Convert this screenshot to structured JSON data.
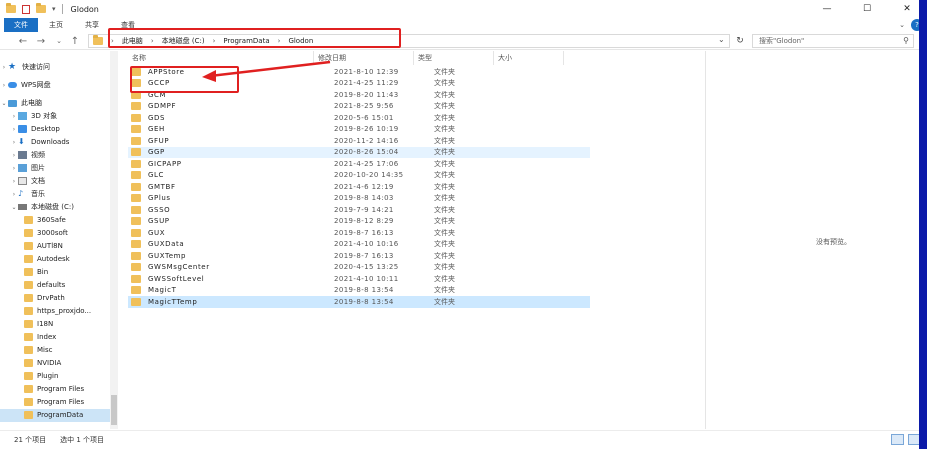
{
  "window": {
    "title": "Glodon",
    "controls": [
      "—",
      "☐",
      "✕"
    ]
  },
  "ribbon": {
    "tabs": [
      "文件",
      "主页",
      "共享",
      "查看"
    ],
    "help_icon": "?"
  },
  "address": {
    "segments": [
      "此电脑",
      "本地磁盘 (C:)",
      "ProgramData",
      "Glodon"
    ],
    "search_placeholder": "搜索\"Glodon\""
  },
  "sidebar": {
    "items": [
      {
        "label": "快速访问",
        "icon": "star-icon"
      },
      {
        "label": "WPS网盘",
        "icon": "cloud-icon"
      },
      {
        "label": "此电脑",
        "icon": "pc-icon"
      },
      {
        "label": "3D 对象",
        "icon": "cube-icon"
      },
      {
        "label": "Desktop",
        "icon": "desktop-icon"
      },
      {
        "label": "Downloads",
        "icon": "download-icon"
      },
      {
        "label": "视频",
        "icon": "video-icon"
      },
      {
        "label": "图片",
        "icon": "picture-icon"
      },
      {
        "label": "文档",
        "icon": "document-icon"
      },
      {
        "label": "音乐",
        "icon": "music-icon"
      },
      {
        "label": "本地磁盘 (C:)",
        "icon": "drive-icon"
      },
      {
        "label": "360Safe",
        "icon": "folder-icon"
      },
      {
        "label": "3000soft",
        "icon": "folder-icon"
      },
      {
        "label": "AUTl8N",
        "icon": "folder-icon"
      },
      {
        "label": "Autodesk",
        "icon": "folder-icon"
      },
      {
        "label": "Bin",
        "icon": "folder-icon"
      },
      {
        "label": "defaults",
        "icon": "folder-icon"
      },
      {
        "label": "DrvPath",
        "icon": "folder-icon"
      },
      {
        "label": "https_proxjdo...",
        "icon": "folder-icon"
      },
      {
        "label": "I18N",
        "icon": "folder-icon"
      },
      {
        "label": "Index",
        "icon": "folder-icon"
      },
      {
        "label": "Misc",
        "icon": "folder-icon"
      },
      {
        "label": "NVIDIA",
        "icon": "folder-icon"
      },
      {
        "label": "Plugin",
        "icon": "folder-icon"
      },
      {
        "label": "Program Files",
        "icon": "folder-icon"
      },
      {
        "label": "Program Files",
        "icon": "folder-icon"
      },
      {
        "label": "ProgramData",
        "icon": "folder-icon"
      }
    ]
  },
  "columns": [
    "名称",
    "修改日期",
    "类型",
    "大小"
  ],
  "files": [
    {
      "name": "APPStore",
      "date": "2021-8-10 12:39",
      "type": "文件夹"
    },
    {
      "name": "GCCP",
      "date": "2021-4-25 11:29",
      "type": "文件夹"
    },
    {
      "name": "GCM",
      "date": "2019-8-20 11:43",
      "type": "文件夹"
    },
    {
      "name": "GDMPF",
      "date": "2021-8-25 9:56",
      "type": "文件夹"
    },
    {
      "name": "GDS",
      "date": "2020-5-6 15:01",
      "type": "文件夹"
    },
    {
      "name": "GEH",
      "date": "2019-8-26 10:19",
      "type": "文件夹"
    },
    {
      "name": "GFUP",
      "date": "2020-11-2 14:16",
      "type": "文件夹"
    },
    {
      "name": "GGP",
      "date": "2020-8-26 15:04",
      "type": "文件夹"
    },
    {
      "name": "GICPAPP",
      "date": "2021-4-25 17:06",
      "type": "文件夹"
    },
    {
      "name": "GLC",
      "date": "2020-10-20 14:35",
      "type": "文件夹"
    },
    {
      "name": "GMTBF",
      "date": "2021-4-6 12:19",
      "type": "文件夹"
    },
    {
      "name": "GPlus",
      "date": "2019-8-8 14:03",
      "type": "文件夹"
    },
    {
      "name": "GSSO",
      "date": "2019-7-9 14:21",
      "type": "文件夹"
    },
    {
      "name": "GSUP",
      "date": "2019-8-12 8:29",
      "type": "文件夹"
    },
    {
      "name": "GUX",
      "date": "2019-8-7 16:13",
      "type": "文件夹"
    },
    {
      "name": "GUXData",
      "date": "2021-4-10 10:16",
      "type": "文件夹"
    },
    {
      "name": "GUXTemp",
      "date": "2019-8-7 16:13",
      "type": "文件夹"
    },
    {
      "name": "GWSMsgCenter",
      "date": "2020-4-15 13:25",
      "type": "文件夹"
    },
    {
      "name": "GWSSoftLevel",
      "date": "2021-4-10 10:11",
      "type": "文件夹"
    },
    {
      "name": "MagicT",
      "date": "2019-8-8 13:54",
      "type": "文件夹"
    },
    {
      "name": "MagicTTemp",
      "date": "2019-8-8 13:54",
      "type": "文件夹"
    }
  ],
  "preview": {
    "message": "没有预览。"
  },
  "status": {
    "count": "21 个项目",
    "selected": "选中 1 个项目"
  },
  "colors": {
    "accent": "#1a6fc4",
    "selection": "#cce8ff",
    "folder": "#f0c05a",
    "annotation": "#e02020"
  }
}
